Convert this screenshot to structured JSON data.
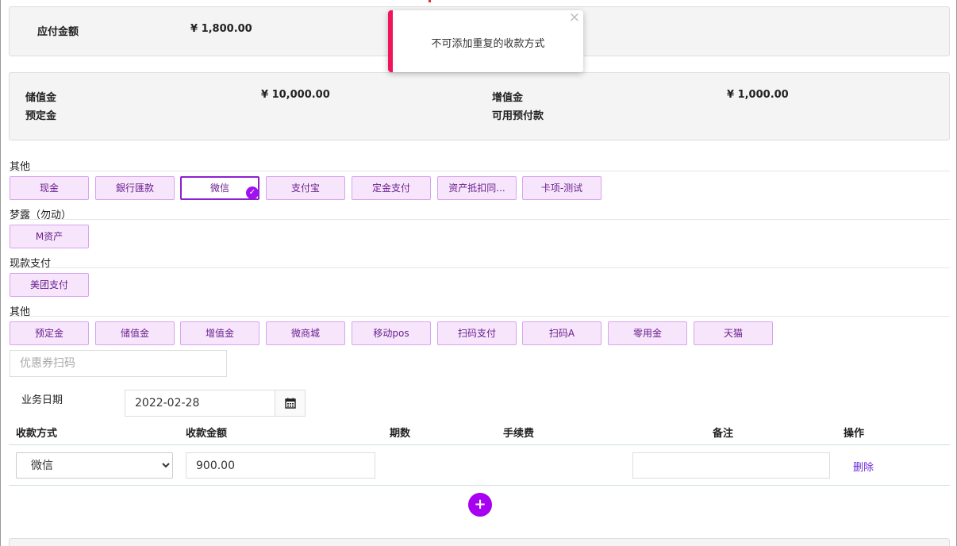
{
  "payable": {
    "label": "应付金额",
    "value": "¥ 1,800.00"
  },
  "balance": {
    "stored_label": "储值金",
    "stored_value": "¥ 10,000.00",
    "deposit_label": "预定金",
    "bonus_label": "增值金",
    "bonus_value": "¥ 1,000.00",
    "prepaid_label": "可用预付款"
  },
  "toast": {
    "message": "不可添加重复的收款方式",
    "close": "×"
  },
  "groups": [
    {
      "title": "其他",
      "buttons": [
        "现金",
        "銀行匯款",
        "微信",
        "支付宝",
        "定金支付",
        "资产抵扣同...",
        "卡项-测试"
      ],
      "selected_index": 2
    },
    {
      "title": "梦露（勿动）",
      "buttons": [
        "M资产"
      ]
    },
    {
      "title": "现款支付",
      "buttons": [
        "美团支付"
      ]
    },
    {
      "title": "其他",
      "buttons": [
        "预定金",
        "储值金",
        "增值金",
        "微商城",
        "移动pos",
        "扫码支付",
        "扫码A",
        "零用金",
        "天猫"
      ]
    }
  ],
  "coupon": {
    "placeholder": "优惠券扫码"
  },
  "business_date": {
    "label": "业务日期",
    "value": "2022-02-28",
    "icon": "calendar-icon"
  },
  "table": {
    "headers": {
      "method": "收款方式",
      "amount": "收款金额",
      "periods": "期数",
      "fee": "手续费",
      "remark": "备注",
      "action": "操作"
    },
    "row": {
      "method": "微信",
      "amount": "900.00",
      "remark": "",
      "action": "删除"
    }
  },
  "add_button": "+",
  "colors": {
    "accent": "#a800f0",
    "toast_bar": "#f0145a",
    "button_bg": "#f7e6fb"
  }
}
